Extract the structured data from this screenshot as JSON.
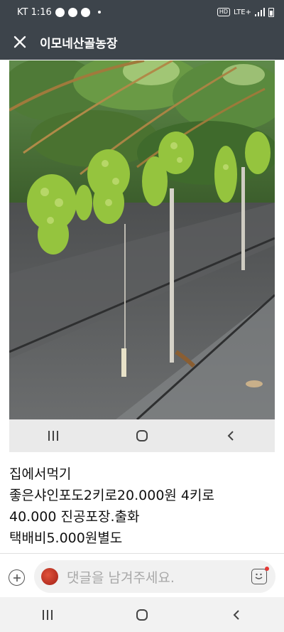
{
  "status": {
    "carrier_time": "KT 1:16",
    "network": "LTE+"
  },
  "header": {
    "title": "이모네산골농장"
  },
  "post": {
    "caption_lines": [
      "집에서먹기",
      "좋은샤인포도2키로20.000원 4키로",
      "40.000 진공포장.출화",
      "택배비5.000원별도"
    ]
  },
  "comment": {
    "placeholder": "댓글을 남겨주세요."
  },
  "colors": {
    "header_bg": "#3d444b",
    "grape_green": "#8fc23a",
    "notification_dot": "#e53935"
  }
}
